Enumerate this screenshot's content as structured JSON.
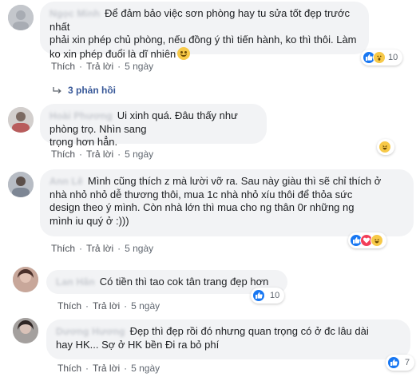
{
  "comments": [
    {
      "author": "Ngọc Minh",
      "text": "Để đảm bảo việc sơn phòng hay tu sửa tốt đẹp trước nhất\nphải xin phép chủ phòng, nếu đồng ý thì tiến hành, ko thì thôi. Làm\nko xin phép đuổi là dĩ nhiên",
      "like": "Thích",
      "reply": "Trả lời",
      "time": "5 ngày",
      "reactions": [
        "like",
        "wow"
      ],
      "reaction_count": "10",
      "replies_label": "3 phản hồi",
      "avatar_color": "#b9bcc2",
      "trailing_emoji": "smile-emoji"
    },
    {
      "author": "Hoài Phương",
      "text": "Ui xinh quá. Đâu thấy như phòng trọ. Nhìn sang\ntrọng hơn hẳn.",
      "like": "Thích",
      "reply": "Trả lời",
      "time": "5 ngày",
      "reactions": [
        "haha"
      ],
      "reaction_count": "",
      "avatar_color": "#c7c2c0"
    },
    {
      "author": "Ann Lê",
      "text": "Mình cũng thích z mà lười vỡ ra. Sau này giàu thì sẽ chỉ thích ở\nnhà nhỏ nhỏ dễ thương thôi, mua 1c nhà nhỏ xíu thôi để thỏa sức\ndesign theo ý mình. Còn nhà lớn thì mua cho ng thân 0r những ng\nmình iu quý ở :)))",
      "like": "Thích",
      "reply": "Trả lời",
      "time": "5 ngày",
      "reactions": [
        "like",
        "love",
        "haha"
      ],
      "reaction_count": "",
      "avatar_color": "#9aa0a8"
    },
    {
      "author": "Lan Hân",
      "text": "Có tiền thì tao cok tân trang đẹp hơn",
      "like": "Thích",
      "reply": "Trả lời",
      "time": "5 ngày",
      "reactions": [
        "like"
      ],
      "reaction_count": "10",
      "avatar_color": "#a9877a"
    },
    {
      "author": "Dương Hương",
      "text": "Đẹp thì đẹp rồi đó nhưng quan trọng có ở đc lâu dài\nhay HK... Sợ ở HK bền Đi ra bỏ phí",
      "like": "Thích",
      "reply": "Trả lời",
      "time": "5 ngày",
      "reactions": [
        "like"
      ],
      "reaction_count": "7",
      "avatar_color": "#8f8b8a"
    }
  ],
  "colors": {
    "bubble": "#f2f3f5",
    "like_blue": "#1877f2",
    "love_red": "#f33e58",
    "haha_yellow": "#f7c948",
    "link_blue": "#385898",
    "meta_gray": "#606770"
  }
}
